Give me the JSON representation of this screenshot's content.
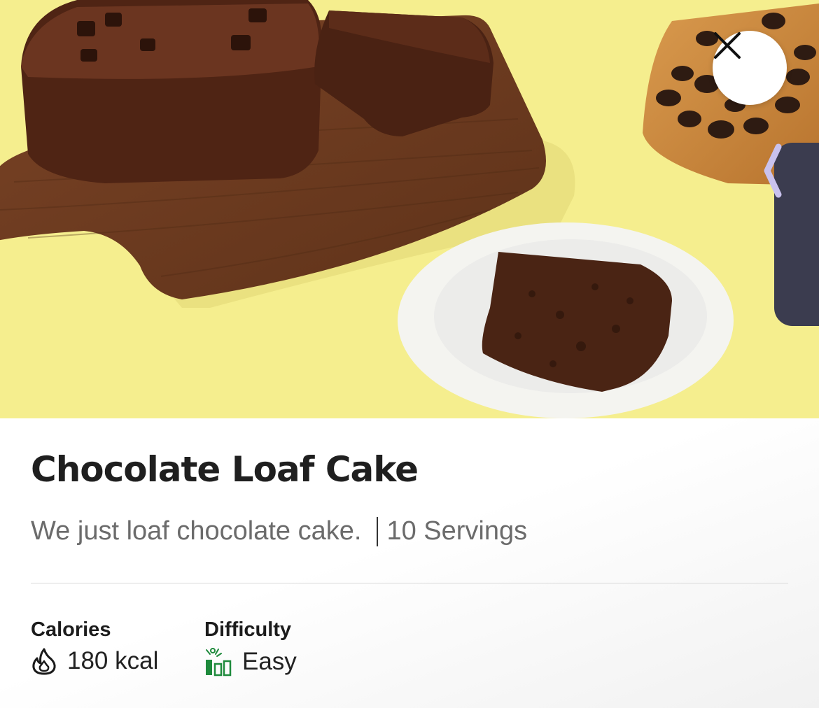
{
  "recipe": {
    "title": "Chocolate Loaf Cake",
    "tagline": "We just loaf chocolate cake.",
    "servings": "10 Servings"
  },
  "stats": {
    "calories": {
      "label": "Calories",
      "value": "180 kcal",
      "icon": "flame-icon"
    },
    "difficulty": {
      "label": "Difficulty",
      "value": "Easy",
      "icon": "difficulty-bars-icon"
    }
  },
  "controls": {
    "close_icon": "close-icon",
    "side_tab_icon": "chevron-left-icon"
  },
  "colors": {
    "hero_background": "#f5ee8e",
    "side_tab": "#3b3c4f",
    "difficulty_icon": "#1e8a3c",
    "chevron": "#c9c2ee"
  }
}
